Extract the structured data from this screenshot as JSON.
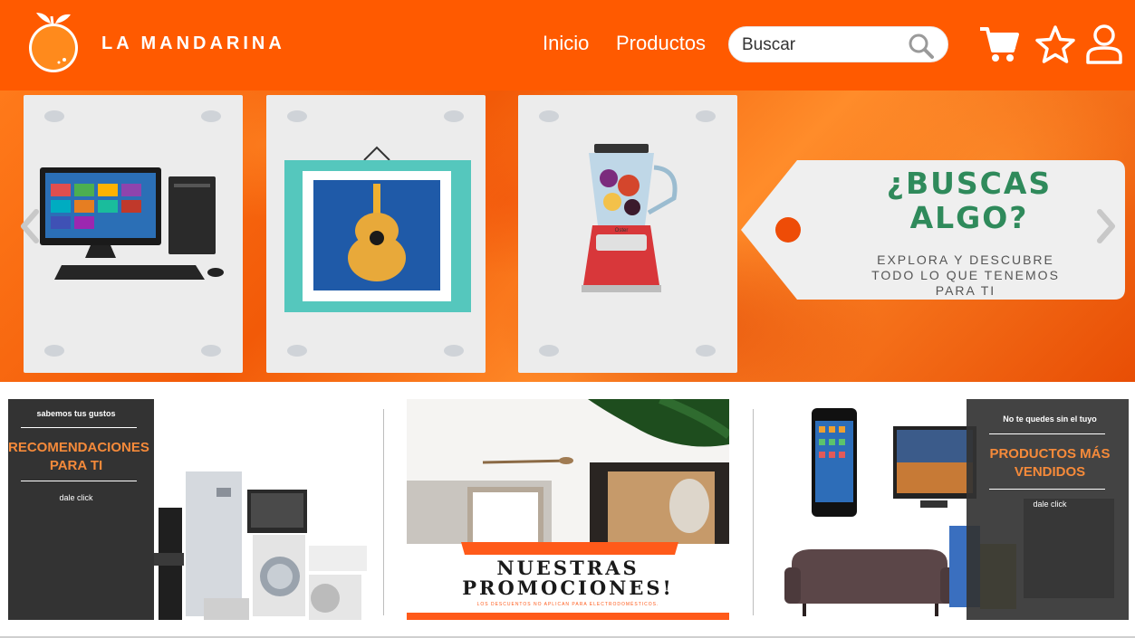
{
  "brand": {
    "name": "LA MANDARINA"
  },
  "nav": {
    "links": [
      "Inicio",
      "Productos"
    ]
  },
  "search": {
    "placeholder": "Buscar"
  },
  "header_icons": [
    "cart-icon",
    "star-icon",
    "user-icon"
  ],
  "colors": {
    "header": "#ff5a00",
    "accent_green": "#2f8a5b",
    "promo_orange": "#f58a3a",
    "dark_panel": "#333333"
  },
  "hero": {
    "tag_title_line1": "¿BUSCAS",
    "tag_title_line2": "ALGO?",
    "tag_sub_line1": "EXPLORA Y DESCUBRE",
    "tag_sub_line2": "TODO LO QUE TENEMOS",
    "tag_sub_line3": "PARA TI",
    "blender_brand": "Oster"
  },
  "promos": {
    "recomendaciones": {
      "kicker": "sabemos tus gustos",
      "title_line1": "RECOMENDACIONES",
      "title_line2": "PARA TI",
      "cta": "dale click"
    },
    "promociones": {
      "title_line1": "NUESTRAS",
      "title_line2": "PROMOCIONES!",
      "fine_print": "LOS DESCUENTOS NO APLICAN PARA ELECTRODOMÉSTICOS."
    },
    "vendidos": {
      "kicker": "No te quedes sin el tuyo",
      "title_line1": "PRODUCTOS MÁS",
      "title_line2": "VENDIDOS",
      "cta": "dale click"
    }
  }
}
